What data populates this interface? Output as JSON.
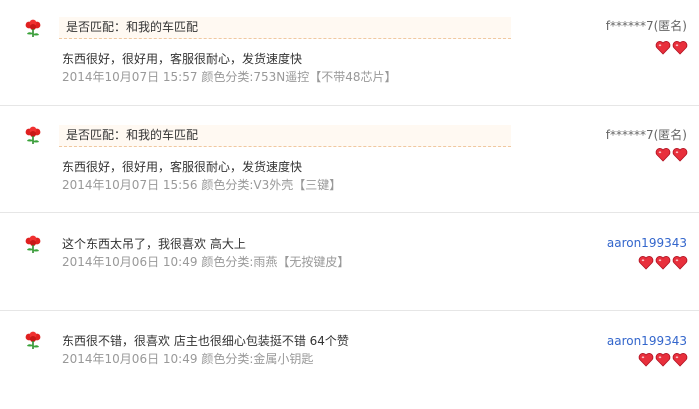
{
  "reviews": [
    {
      "match": "是否匹配：和我的车匹配",
      "content": "东西很好，很好用，客服很耐心，发货速度快",
      "date": "2014年10月07日 15:57",
      "sku_label": "颜色分类:",
      "sku_value": "753N遥控【不带48芯片】",
      "user": "f******7(匿名)",
      "hearts": 2
    },
    {
      "match": "是否匹配：和我的车匹配",
      "content": "东西很好，很好用，客服很耐心，发货速度快",
      "date": "2014年10月07日 15:56",
      "sku_label": "颜色分类:",
      "sku_value": "V3外壳【三键】",
      "user": "f******7(匿名)",
      "hearts": 2
    },
    {
      "content": "这个东西太吊了，我很喜欢 高大上",
      "date": "2014年10月06日 10:49",
      "sku_label": "颜色分类:",
      "sku_value": "雨燕【无按键皮】",
      "user": "aaron199343",
      "hearts": 3
    },
    {
      "content": "东西很不错，很喜欢 店主也很细心包装挺不错 64个赞",
      "date": "2014年10月06日 10:49",
      "sku_label": "颜色分类:",
      "sku_value": "金属小钥匙",
      "user": "aaron199343",
      "hearts": 3
    }
  ],
  "icons": {
    "flower": "rose-flower-icon",
    "heart": "buyer-rank-heart-icon"
  },
  "colors": {
    "heart": "#e8303c",
    "username_link": "#3366cc",
    "match_bg": "#fff9f2"
  }
}
